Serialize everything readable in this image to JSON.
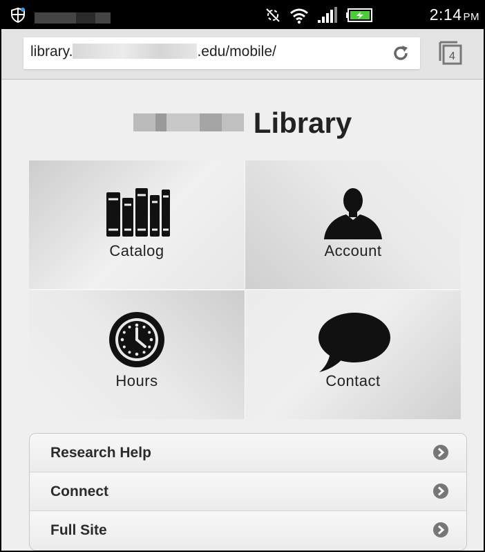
{
  "status_bar": {
    "time": "2:14",
    "ampm": "PM",
    "icons": [
      "shield-icon",
      "sync-off-icon",
      "wifi-icon",
      "signal-icon",
      "battery-charging-icon"
    ]
  },
  "browser": {
    "url_prefix": "library.",
    "url_suffix": ".edu/mobile/",
    "tab_count": "4"
  },
  "page": {
    "title_suffix": "Library",
    "tiles": [
      {
        "label": "Catalog",
        "icon": "books-icon"
      },
      {
        "label": "Account",
        "icon": "person-icon"
      },
      {
        "label": "Hours",
        "icon": "clock-icon"
      },
      {
        "label": "Contact",
        "icon": "speech-bubble-icon"
      }
    ],
    "links": [
      {
        "label": "Research Help"
      },
      {
        "label": "Connect"
      },
      {
        "label": "Full Site"
      }
    ]
  },
  "colors": {
    "status_bar": "#000000",
    "page_bg": "#efefef",
    "text": "#222222",
    "icon": "#111111"
  }
}
